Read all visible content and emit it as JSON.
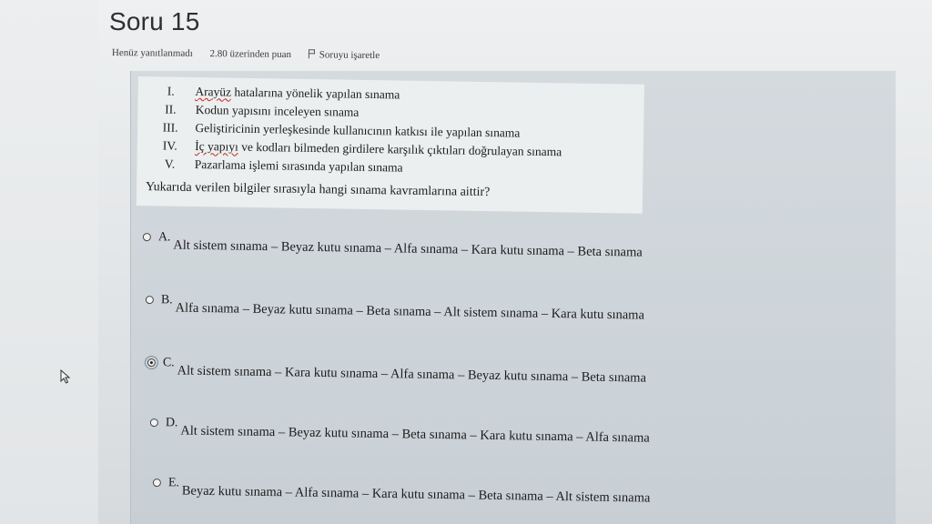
{
  "page": {
    "title": "Soru 15"
  },
  "meta": {
    "status": "Henüz yanıtlanmadı",
    "points": "2.80 üzerinden puan",
    "flag_label": "Soruyu işaretle",
    "flag_icon": "flag-icon"
  },
  "question": {
    "statements": [
      {
        "numeral": "I.",
        "text": "hatalarına yönelik yapılan sınama",
        "marked_word": "Arayüz"
      },
      {
        "numeral": "II.",
        "text": "Kodun yapısını inceleyen sınama"
      },
      {
        "numeral": "III.",
        "text": "Geliştiricinin yerleşkesinde kullanıcının katkısı ile yapılan sınama"
      },
      {
        "numeral": "IV.",
        "text": "ve kodları bilmeden girdilere karşılık çıktıları doğrulayan sınama",
        "marked_word": "İç yapıyı"
      },
      {
        "numeral": "V.",
        "text": "Pazarlama işlemi sırasında yapılan sınama"
      }
    ],
    "prompt": "Yukarıda verilen bilgiler sırasıyla hangi sınama kavramlarına aittir?"
  },
  "options": [
    {
      "letter": "A.",
      "text": "Alt sistem sınama – Beyaz kutu sınama – Alfa sınama – Kara kutu sınama – Beta sınama",
      "selected": false
    },
    {
      "letter": "B.",
      "text": "Alfa sınama – Beyaz kutu sınama – Beta sınama – Alt sistem sınama – Kara kutu sınama",
      "selected": false
    },
    {
      "letter": "C.",
      "text": "Alt sistem sınama – Kara kutu sınama – Alfa sınama – Beyaz kutu sınama – Beta sınama",
      "selected": true
    },
    {
      "letter": "D.",
      "text": "Alt sistem sınama – Beyaz kutu sınama – Beta sınama – Kara kutu sınama – Alfa sınama",
      "selected": false
    },
    {
      "letter": "E.",
      "text": "Beyaz kutu sınama – Alfa sınama – Kara kutu sınama – Beta sınama – Alt sistem sınama",
      "selected": false
    }
  ],
  "colors": {
    "question_area": "#cdd4d9",
    "statement_box": "#ecefef",
    "spellcheck_underline": "#cc2222"
  },
  "cursor_icon": "mouse-pointer-icon"
}
